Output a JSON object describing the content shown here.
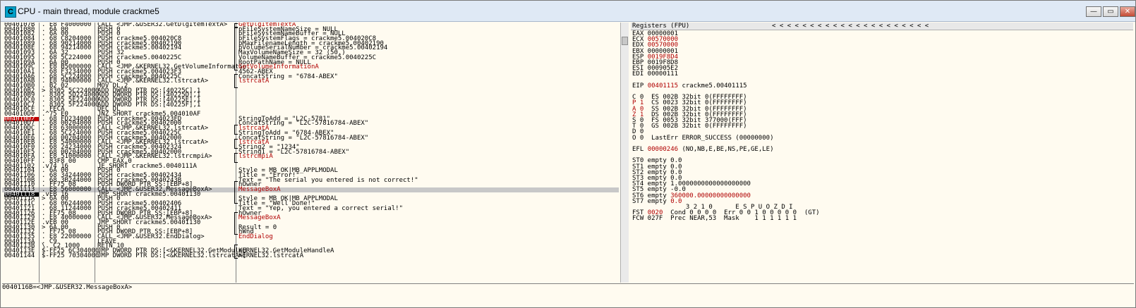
{
  "window": {
    "title": "CPU - main thread, module crackme5",
    "icon_letter": "C"
  },
  "controls": {
    "minimize": "—",
    "restore": "▭",
    "close": "✕"
  },
  "disasm": [
    {
      "a": "0040107B",
      "h": ". E8 F4000000",
      "i": "CALL <JMP.&USER32.GetDlgItemTextA>",
      "c": "GetDlgItemTextA",
      "cc": "red"
    },
    {
      "a": "00401080",
      "h": ". 6A 00",
      "i": "PUSH 0",
      "c": "pFileSystemNameSize = NULL"
    },
    {
      "a": "00401082",
      "h": ". 6A 00",
      "i": "PUSH 0",
      "c": "pFileSystemNameBuffer = NULL"
    },
    {
      "a": "00401084",
      "h": ". 68 C8204000",
      "i": "PUSH crackme5.004020C8",
      "c": "pFileSystemFlags = crackme5.004020C8"
    },
    {
      "a": "00401089",
      "h": ". 68 90214000",
      "i": "PUSH crackme5.00402190",
      "c": "pMaxFilenameLength = crackme5.00402190"
    },
    {
      "a": "0040108E",
      "h": ". 68 94214000",
      "i": "PUSH crackme5.00402194",
      "c": "pVolumeSerialNumber = crackme5.00402194"
    },
    {
      "a": "00401093",
      "h": ". 6A 32",
      "i": "PUSH 32",
      "c": "MaxVolumeNameSize = 32 (50.)"
    },
    {
      "a": "00401095",
      "h": ". 68 5C224000",
      "i": "PUSH crackme5.0040225C",
      "c": "VolumeNameBuffer = crackme5.0040225C"
    },
    {
      "a": "0040109A",
      "h": ". 6A 00",
      "i": "PUSH 0",
      "c": "RootPathName = NULL"
    },
    {
      "a": "0040109C",
      "h": ". E8 B5000000",
      "i": "CALL <JMP.&KERNEL32.GetVolumeInformatio",
      "c": "GetVolumeInformationA",
      "cc": "red"
    },
    {
      "a": "004010A1",
      "h": ". 68 F3234000",
      "i": "PUSH crackme5.004023F3",
      "c": "4562-ABEX"
    },
    {
      "a": "004010A6",
      "h": ". 68 5C224000",
      "i": "PUSH crackme5.0040225C",
      "c": "ConcatString = \"6784-ABEX\""
    },
    {
      "a": "004010AB",
      "h": ". E8 94000000",
      "i": "CALL <JMP.&KERNEL32.lstrcatA>",
      "c": "lstrcatA",
      "cc": "red"
    },
    {
      "a": "004010B0",
      "h": ". B2 02",
      "i": "MOV DL,2",
      "c": ""
    },
    {
      "a": "004010B2",
      "h": "> 8305 5C224000",
      "i": "ADD DWORD PTR DS:[40225C],1",
      "c": ""
    },
    {
      "a": "004010B9",
      "h": ". 8305 5D224000",
      "i": "ADD DWORD PTR DS:[40225D],1",
      "c": ""
    },
    {
      "a": "004010C0",
      "h": ". 8305 5E224000",
      "i": "ADD DWORD PTR DS:[40225E],1",
      "c": ""
    },
    {
      "a": "004010C7",
      "h": ". 8305 5F224000",
      "i": "ADD DWORD PTR DS:[40225F],1",
      "c": ""
    },
    {
      "a": "004010CE",
      "h": ". FECA",
      "i": "DEC DL",
      "c": ""
    },
    {
      "a": "004010D0",
      "h": ".^75 E0",
      "i": "JNZ SHORT crackme5.004010AF",
      "c": ""
    },
    {
      "a": "004010D2",
      "h": ". 68 FD234000",
      "i": "PUSH crackme5.004023FD",
      "c": "StringToAdd = \"L2C-5781\"",
      "ac": "bp"
    },
    {
      "a": "004010D7",
      "h": ". 68 00204000",
      "i": "PUSH crackme5.00402000",
      "c": "ConcatString = \"L2C-57816784-ABEX\""
    },
    {
      "a": "004010DC",
      "h": ". E8 63000000",
      "i": "CALL <JMP.&KERNEL32.lstrcatA>",
      "c": "lstrcatA",
      "cc": "red"
    },
    {
      "a": "004010E1",
      "h": ". 68 5C224000",
      "i": "PUSH crackme5.0040225C",
      "c": "StringToAdd = \"6784-ABEX\""
    },
    {
      "a": "004010E6",
      "h": ". 68 00204000",
      "i": "PUSH crackme5.00402000",
      "c": "ConcatString = \"L2C-57816784-ABEX\""
    },
    {
      "a": "004010EB",
      "h": ". E8 54000000",
      "i": "CALL <JMP.&KERNEL32.lstrcatA>",
      "c": "lstrcatA",
      "cc": "red"
    },
    {
      "a": "004010F0",
      "h": ". 68 24234000",
      "i": "PUSH crackme5.00402324",
      "c": "String2 = \"1234\""
    },
    {
      "a": "004010F5",
      "h": ". 68 00204000",
      "i": "PUSH crackme5.00402000",
      "c": "String1 = \"L2C-57816784-ABEX\""
    },
    {
      "a": "004010FA",
      "h": ". E8 51000000",
      "i": "CALL <JMP.&KERNEL32.lstrcmpiA>",
      "c": "lstrcmpiA",
      "cc": "red"
    },
    {
      "a": "004010FF",
      "h": ". 83F8 00",
      "i": "CMP EAX,0",
      "c": ""
    },
    {
      "a": "00401102",
      "h": ".v74 16",
      "i": "JE SHORT crackme5.0040111A",
      "c": ""
    },
    {
      "a": "00401104",
      "h": ". 6A 00",
      "i": "PUSH 0",
      "c": "Style = MB_OK|MB_APPLMODAL"
    },
    {
      "a": "00401106",
      "h": ". 68 34244000",
      "i": "PUSH crackme5.00402434",
      "c": "Title = \"Error!\""
    },
    {
      "a": "0040110B",
      "h": ". 68 3B244000",
      "i": "PUSH crackme5.0040243B",
      "c": "Text = \"The serial you entered is not correct!\""
    },
    {
      "a": "00401110",
      "h": ". FF75 08",
      "i": "PUSH DWORD PTR SS:[EBP+8]",
      "c": "hOwner"
    },
    {
      "a": "00401113",
      "h": ". E8 56000000",
      "i": "CALL <JMP.&USER32.MessageBoxA>",
      "c": "MessageBoxA",
      "cc": "red",
      "sel": true
    },
    {
      "a": "00401118",
      "h": ".vEB 16",
      "i": "JMP SHORT crackme5.00401130",
      "c": "",
      "ac": "hi"
    },
    {
      "a": "0040111A",
      "h": "> 6A 00",
      "i": "PUSH 0",
      "c": "Style = MB_OK|MB_APPLMODAL"
    },
    {
      "a": "0040111C",
      "h": ". 68 06244000",
      "i": "PUSH crackme5.00402406",
      "c": "Title = \"Well Done!\""
    },
    {
      "a": "00401121",
      "h": ". 68 11244000",
      "i": "PUSH crackme5.00402411",
      "c": "Text = \"Yep, you entered a correct serial!\""
    },
    {
      "a": "00401126",
      "h": ". FF75 08",
      "i": "PUSH DWORD PTR SS:[EBP+8]",
      "c": "hOwner"
    },
    {
      "a": "00401129",
      "h": ". E8 40000000",
      "i": "CALL <JMP.&USER32.MessageBoxA>",
      "c": "MessageBoxA",
      "cc": "red"
    },
    {
      "a": "0040112E",
      "h": ".vEB 00",
      "i": "JMP SHORT crackme5.00401130",
      "c": ""
    },
    {
      "a": "00401130",
      "h": "> 6A 00",
      "i": "PUSH 0",
      "c": "Result = 0"
    },
    {
      "a": "00401132",
      "h": ". FF75 08",
      "i": "PUSH DWORD PTR SS:[EBP+8]",
      "c": "hWnd"
    },
    {
      "a": "00401135",
      "h": ". E8 22000000",
      "i": "CALL <JMP.&USER32.EndDialog>",
      "c": "EndDialog",
      "cc": "red"
    },
    {
      "a": "0040113A",
      "h": ". C9",
      "i": "LEAVE",
      "c": ""
    },
    {
      "a": "0040113B",
      "h": "\\. C2 1000",
      "i": "RETN 10",
      "c": ""
    },
    {
      "a": "0040113E",
      "h": "$-FF25 6C304000",
      "i": "JMP DWORD PTR DS:[<&KERNEL32.GetModuleH",
      "c": "KERNEL32.GetModuleHandleA"
    },
    {
      "a": "00401144",
      "h": "$-FF25 70304000",
      "i": "JMP DWORD PTR DS:[<&KERNEL32.lstrcatA>]",
      "c": "KERNEL32.lstrcatA"
    }
  ],
  "registers": {
    "header": "Registers (FPU)",
    "arrows": "<     <     <     <     <     <     <     <     <     <     <     <     <     <     <     <     <     <     <     <     <",
    "lines": [
      {
        "t": "EAX 00000001"
      },
      {
        "t": "ECX ",
        "v": "00570000",
        "r": true
      },
      {
        "t": "EDX ",
        "v": "00570000",
        "r": true
      },
      {
        "t": "EBX 00000001"
      },
      {
        "t": "ESP ",
        "v": "0019F8D4",
        "r": true
      },
      {
        "t": "EBP 0019F8D8"
      },
      {
        "t": "ESI 000905E2"
      },
      {
        "t": "EDI 00000111"
      },
      {
        "t": ""
      },
      {
        "t": "EIP ",
        "v": "00401115",
        "r": true,
        "s": " crackme5.00401115"
      },
      {
        "t": ""
      },
      {
        "t": "C 0  ES 002B 32bit 0(FFFFFFFF)"
      },
      {
        "t": "",
        "v": "P 1",
        "r": true,
        "s": "  CS 0023 32bit 0(FFFFFFFF)"
      },
      {
        "t": "",
        "v": "A 0",
        "r": true,
        "s": "  SS 002B 32bit 0(FFFFFFFF)"
      },
      {
        "t": "",
        "v": "Z 1",
        "r": true,
        "s": "  DS 002B 32bit 0(FFFFFFFF)"
      },
      {
        "t": "S 0  FS 0053 32bit 377000(FFF)"
      },
      {
        "t": "T 0  GS 002B 32bit 0(FFFFFFFF)"
      },
      {
        "t": "D 0"
      },
      {
        "t": "O 0  LastErr ERROR_SUCCESS (00000000)"
      },
      {
        "t": ""
      },
      {
        "t": "EFL ",
        "v": "00000246",
        "r": true,
        "s": " (NO,NB,E,BE,NS,PE,GE,LE)"
      },
      {
        "t": ""
      },
      {
        "t": "ST0 empty 0.0"
      },
      {
        "t": "ST1 empty 0.0"
      },
      {
        "t": "ST2 empty 0.0"
      },
      {
        "t": "ST3 empty 0.0"
      },
      {
        "t": "ST4 empty 1.0000000000000000000"
      },
      {
        "t": "ST5 empty -0.0"
      },
      {
        "t": "ST6 empty ",
        "v": "360000.00000000000000",
        "r": true
      },
      {
        "t": "ST7 empty ",
        "v": "0.0",
        "r": true
      },
      {
        "t": "              3 2 1 0      E S P U O Z D I"
      },
      {
        "t": "FST ",
        "v": "0020",
        "r": true,
        "s": "  Cond 0 0 0 0  Err 0 0 1 0 0 0 0 0  (GT)"
      },
      {
        "t": "FCW 027F  Prec NEAR,53  Mask    1 1 1 1 1 1"
      }
    ]
  },
  "info": {
    "text": "0040116B=<JMP.&USER32.MessageBoxA>"
  }
}
